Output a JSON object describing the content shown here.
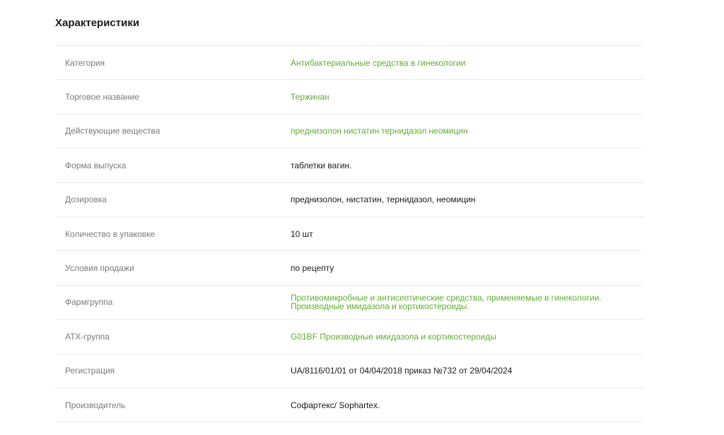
{
  "section": {
    "title": "Характеристики"
  },
  "rows": [
    {
      "label": "Категория",
      "value": "Антибактериальные средства в гинекологии"
    },
    {
      "label": "Торговое название",
      "value": "Тержинан"
    },
    {
      "label": "Действующие вещества",
      "substances": [
        "преднизолон",
        "нистатин",
        "тернидазол",
        "неомицин"
      ]
    },
    {
      "label": "Форма выпуска",
      "value": "таблетки вагин."
    },
    {
      "label": "Дозировка",
      "value": "преднизолон, нистатин, тернидазол, неомицин"
    },
    {
      "label": "Количество в упаковке",
      "value": "10 шт"
    },
    {
      "label": "Условия продажи",
      "value": "по рецепту"
    },
    {
      "label": "Фармгруппа",
      "value": "Противомикробные и антисептические средства, применяемые в гинекологии. Производные имидазола и кортикостероиды."
    },
    {
      "label": "АТХ-группа",
      "value": "G01BF Производные имидазола и кортикостероиды"
    },
    {
      "label": "Регистрация",
      "value": "UA/8116/01/01 от 04/04/2018 приказ №732 от 29/04/2024"
    },
    {
      "label": "Производитель",
      "value": "Софартекс/ Sophartex."
    }
  ],
  "colors": {
    "link": "#5fae32",
    "label": "#7a7a7a",
    "text": "#1a1a1a",
    "divider": "#ebebeb"
  }
}
